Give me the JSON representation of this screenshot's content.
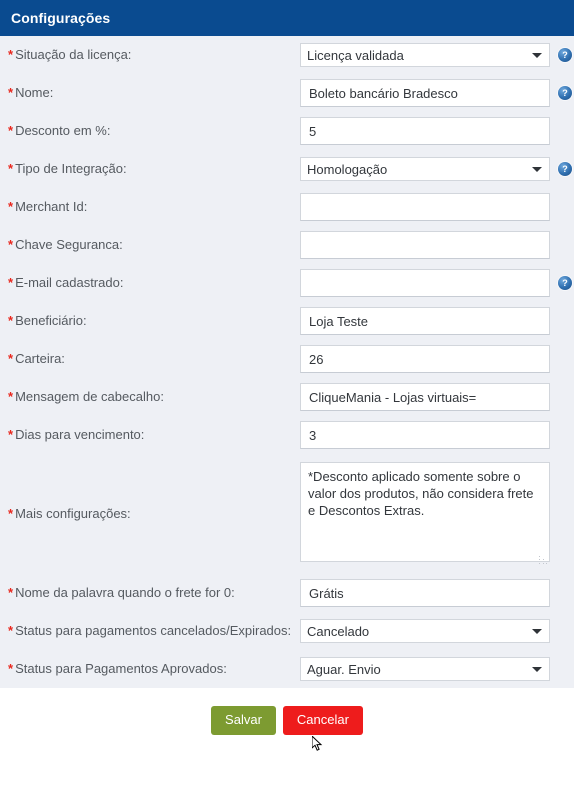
{
  "header": {
    "title": "Configurações"
  },
  "form": {
    "required_marker": "*",
    "rows": [
      {
        "label": "Situação da licença:",
        "type": "select",
        "value": "Licença validada",
        "help": true,
        "name": "situacao-da-licenca"
      },
      {
        "label": "Nome:",
        "type": "text",
        "value": "Boleto bancário Bradesco",
        "placeholder": "",
        "help": true,
        "name": "nome"
      },
      {
        "label": "Desconto em %:",
        "type": "text",
        "value": "5",
        "placeholder": "",
        "help": false,
        "name": "desconto-em-porcento"
      },
      {
        "label": "Tipo de Integração:",
        "type": "select",
        "value": "Homologação",
        "help": true,
        "name": "tipo-de-integracao"
      },
      {
        "label": "Merchant Id:",
        "type": "text",
        "value": "",
        "placeholder": "",
        "help": false,
        "name": "merchant-id"
      },
      {
        "label": "Chave Seguranca:",
        "type": "text",
        "value": "",
        "placeholder": "",
        "help": false,
        "name": "chave-seguranca"
      },
      {
        "label": "E-mail cadastrado:",
        "type": "text",
        "value": "",
        "placeholder": "",
        "help": true,
        "name": "email-cadastrado"
      },
      {
        "label": "Beneficiário:",
        "type": "text",
        "value": "Loja Teste",
        "placeholder": "",
        "help": false,
        "name": "beneficiario"
      },
      {
        "label": "Carteira:",
        "type": "text",
        "value": "26",
        "placeholder": "",
        "help": false,
        "name": "carteira"
      },
      {
        "label": "Mensagem de cabecalho:",
        "type": "text",
        "value": "CliqueMania - Lojas virtuais=",
        "placeholder": "",
        "help": false,
        "name": "mensagem-de-cabecalho"
      },
      {
        "label": "Dias para vencimento:",
        "type": "text",
        "value": "3",
        "placeholder": "",
        "help": false,
        "name": "dias-para-vencimento"
      },
      {
        "label": "Mais configurações:",
        "type": "textarea",
        "value": "*Desconto aplicado somente sobre o valor dos produtos, não considera frete e Descontos Extras.",
        "placeholder": "",
        "help": false,
        "name": "mais-configuracoes"
      },
      {
        "label": "Nome da palavra quando o frete for 0:",
        "type": "text",
        "value": "Grátis",
        "placeholder": "",
        "help": false,
        "name": "nome-da-palavra-frete-zero"
      },
      {
        "label": "Status para pagamentos cancelados/Expirados:",
        "type": "select",
        "value": "Cancelado",
        "help": false,
        "name": "status-pagamentos-cancelados"
      },
      {
        "label": "Status para Pagamentos Aprovados:",
        "type": "select",
        "value": "Aguar. Envio",
        "help": false,
        "name": "status-pagamentos-aprovados"
      }
    ]
  },
  "footer": {
    "save_label": "Salvar",
    "cancel_label": "Cancelar"
  },
  "icons": {
    "help": "?"
  },
  "colors": {
    "header_bg": "#0a4b90",
    "body_bg": "#eef0f5",
    "required": "#e8271d",
    "save": "#7d9b31",
    "cancel": "#ee1c1c",
    "help_icon": "#2f6fb0"
  }
}
